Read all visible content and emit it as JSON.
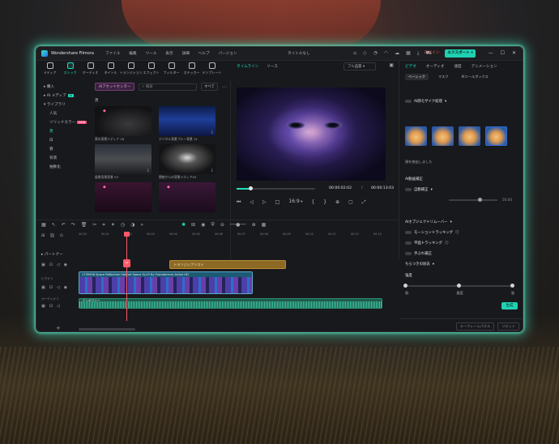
{
  "app": {
    "name": "Wondershare Filmora",
    "project_title": "タイトルなし"
  },
  "menu": [
    "ファイル",
    "編集",
    "ツール",
    "表示",
    "詳細",
    "ヘルプ",
    "バージョン"
  ],
  "titlebar": {
    "login": "ログイン",
    "export": "エクスポート ▾"
  },
  "toolbar": [
    {
      "label": "メディア",
      "icon": "media-icon"
    },
    {
      "label": "ストック",
      "icon": "stock-icon",
      "active": true
    },
    {
      "label": "オーディオ",
      "icon": "audio-icon"
    },
    {
      "label": "タイトル",
      "icon": "title-icon"
    },
    {
      "label": "トランジション",
      "icon": "transition-icon"
    },
    {
      "label": "エフェクト",
      "icon": "effect-icon"
    },
    {
      "label": "フィルター",
      "icon": "filter-icon"
    },
    {
      "label": "ステッカー",
      "icon": "sticker-icon"
    },
    {
      "label": "テンプレート",
      "icon": "template-icon"
    }
  ],
  "sidebar": {
    "items": [
      {
        "label": "購入",
        "type": "group"
      },
      {
        "label": "AI メディア",
        "type": "group",
        "badge": "AI"
      },
      {
        "label": "ライブラリ",
        "type": "group"
      },
      {
        "label": "人気",
        "type": "sub"
      },
      {
        "label": "ソリッドカラー",
        "type": "sub",
        "badge": "NEW"
      },
      {
        "label": "黒",
        "type": "sub",
        "selected": true
      },
      {
        "label": "白",
        "type": "sub"
      },
      {
        "label": "春",
        "type": "sub"
      },
      {
        "label": "背景",
        "type": "sub"
      },
      {
        "label": "抽象化",
        "type": "sub"
      }
    ],
    "partner": "パートナー"
  },
  "media": {
    "asset_button": "AIアセットセンター",
    "search_placeholder": "検索",
    "sort": "すべて",
    "category": "黒",
    "items": [
      {
        "caption": "黒の背景メディア 18"
      },
      {
        "caption": "デジタル背景ブルー背景 12"
      },
      {
        "caption": "風景背景背景 03"
      },
      {
        "caption": "闇夜からの背景メディア04"
      },
      {
        "caption": ""
      },
      {
        "caption": ""
      }
    ]
  },
  "preview": {
    "tabs": [
      "タイムライン",
      "ソース"
    ],
    "quality": "フル品質",
    "time_current": "00:00:02:02",
    "time_separator": "/",
    "time_total": "00:00:13:03",
    "ratio": "16:9"
  },
  "props": {
    "tabs": [
      "ビデオ",
      "オーディオ",
      "速度",
      "アニメーション"
    ],
    "subtabs": [
      "ベーシック",
      "マスク",
      "AIツールボックス"
    ],
    "mosaic": "AI顔モザイク処理",
    "face_note": "顔を検出しました",
    "stabilize": "AI動画補正",
    "auto_correct": "自動補正",
    "slider_value": "50.00",
    "remover": "AIオブジェクトリムーバー",
    "motion_tracking": "モーショントラッキング",
    "plane_tracking": "平面トラッキング",
    "shake_correct": "手ぶれ補正",
    "blur_removal": "ちらつきの除去",
    "strength": "強度",
    "str_low": "弱",
    "str_mid": "適度",
    "str_high": "強",
    "generate": "生成",
    "footer_keyframe": "キーフレームパネル",
    "footer_reset": "リセット"
  },
  "timeline": {
    "ruler": [
      "00:00",
      "00:01",
      "00:02",
      "00:03",
      "00:04",
      "00:05",
      "00:06",
      "00:07",
      "00:08",
      "00:09",
      "00:10",
      "00:11",
      "00:12",
      "00:13"
    ],
    "title_clip": "トランジシブリスト",
    "video_clip": "1739458 Space Reflection Helmet Space Sci-Fi By Frontalnerve Artlist HD",
    "audio_clip": "テンポラリー",
    "track_video": "ビデオ 1",
    "track_audio": "オーディオ 1"
  }
}
